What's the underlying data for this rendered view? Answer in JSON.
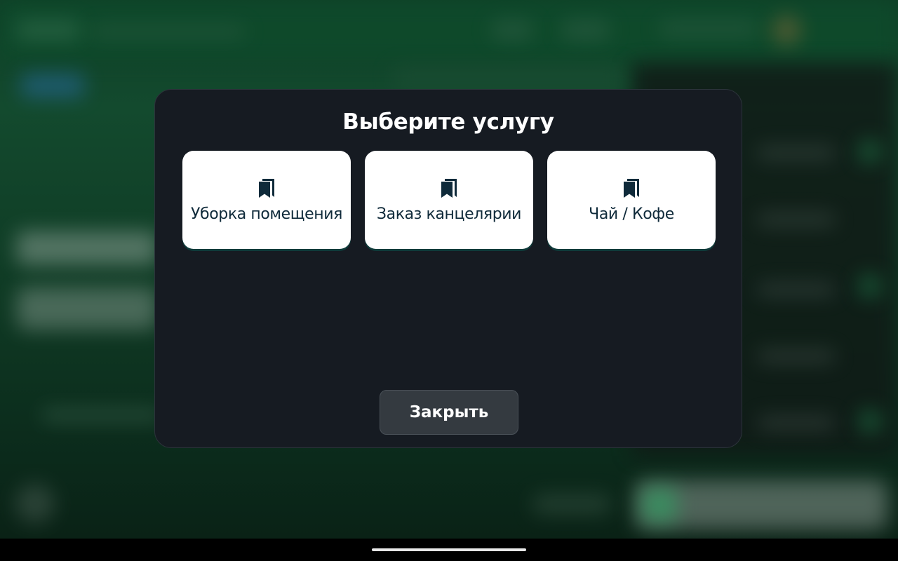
{
  "modal": {
    "title": "Выберите услугу",
    "services": [
      {
        "label": "Уборка помещения",
        "icon": "bookmarks-icon"
      },
      {
        "label": "Заказ канцелярии",
        "icon": "bookmarks-icon"
      },
      {
        "label": "Чай / Кофе",
        "icon": "bookmarks-icon"
      }
    ],
    "close_label": "Закрыть"
  },
  "colors": {
    "background_green": "#134a2e",
    "modal_bg": "#161b22",
    "card_bg": "#ffffff",
    "card_text": "#0f2a3a",
    "button_bg": "#343a40"
  }
}
